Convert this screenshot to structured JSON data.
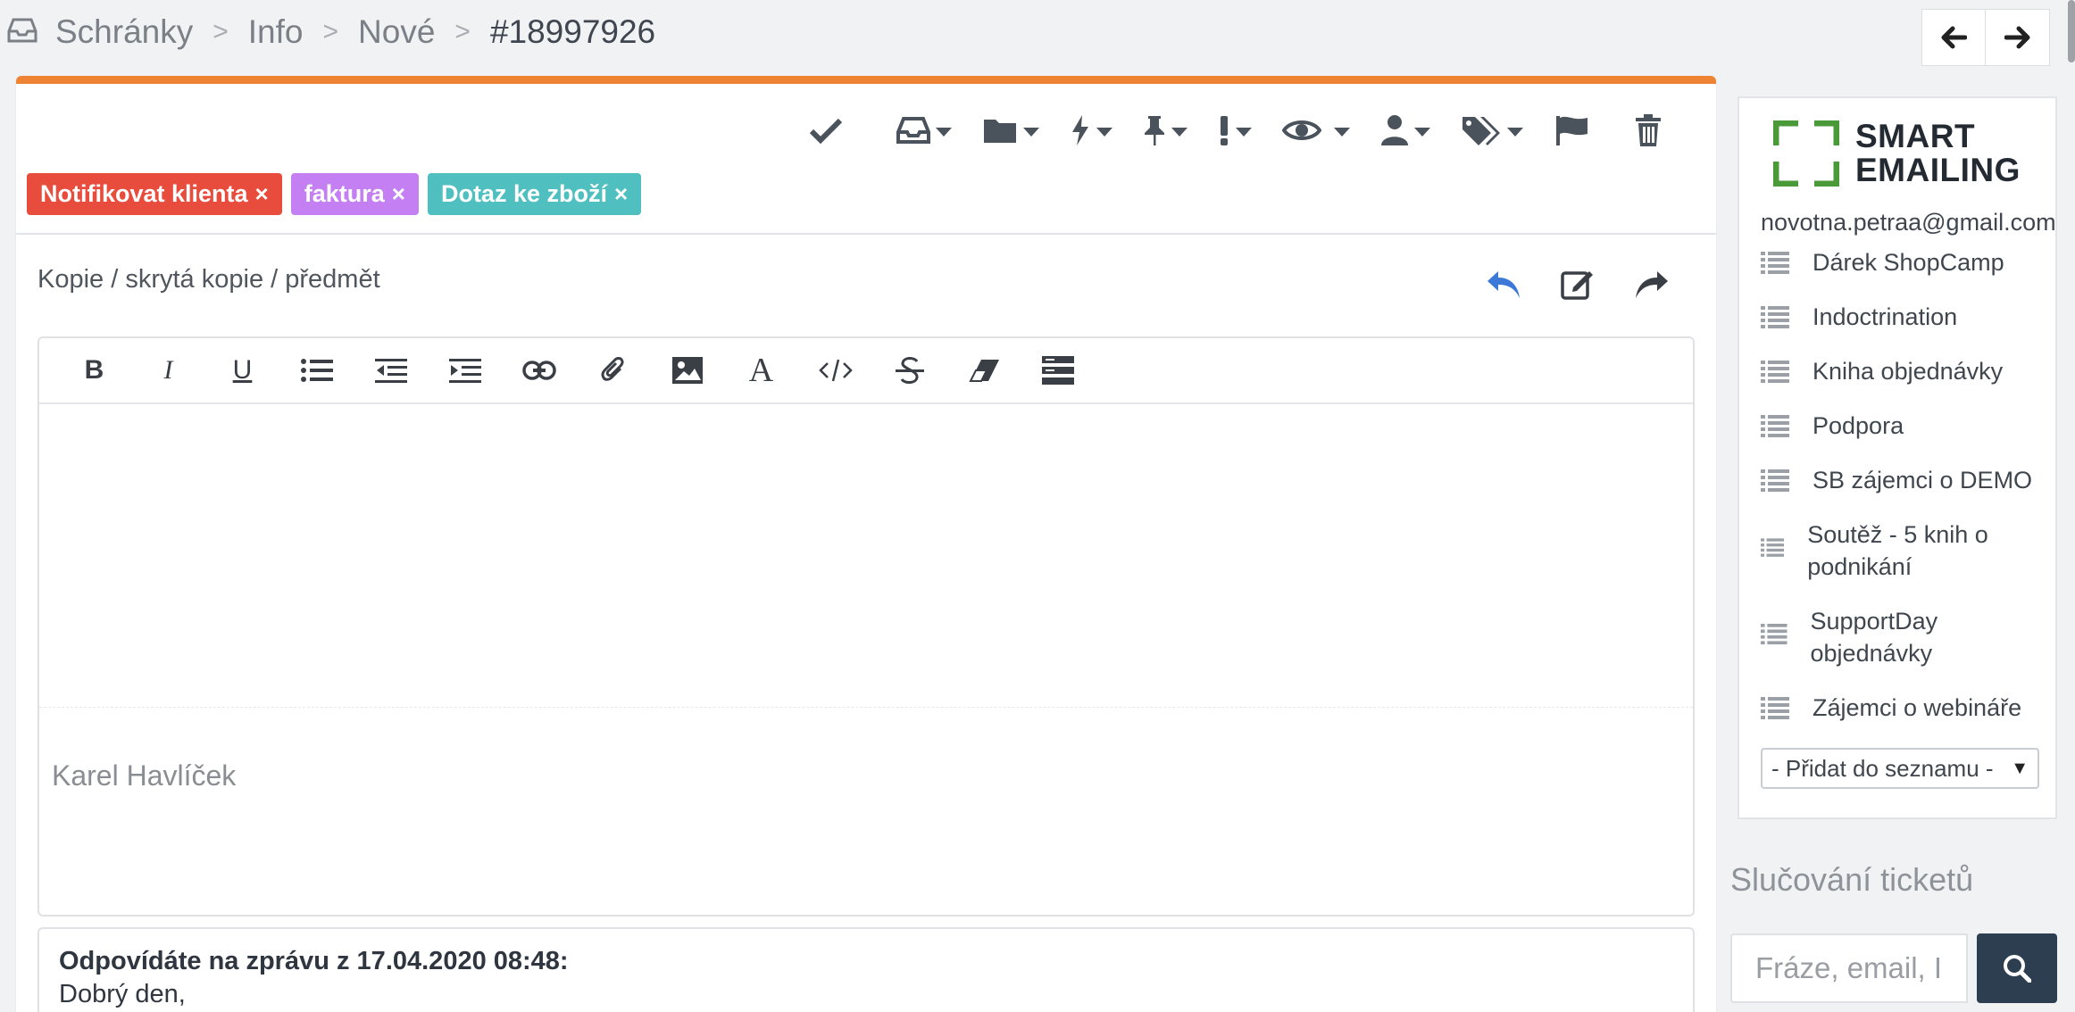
{
  "breadcrumb": {
    "items": [
      "Schránky",
      "Info",
      "Nové",
      "#18997926"
    ],
    "separator": ">"
  },
  "nav": {
    "prev_icon": "arrow-left-icon",
    "next_icon": "arrow-right-icon"
  },
  "colors": {
    "accent_bar": "#ee8433",
    "tag_notify": "#e74c3c",
    "tag_invoice": "#c47ff2",
    "tag_question": "#4fbfbf",
    "reply_blue": "#3b78d8",
    "search_button": "#2c3e50"
  },
  "toolbar": {
    "icons": [
      "check-icon",
      "inbox-icon",
      "folder-icon",
      "bolt-icon",
      "pin-icon",
      "priority-icon",
      "eye-icon",
      "user-icon",
      "tags-icon",
      "flag-icon",
      "trash-icon"
    ]
  },
  "tags": [
    {
      "label": "Notifikovat klienta",
      "remove": "×"
    },
    {
      "label": "faktura",
      "remove": "×"
    },
    {
      "label": "Dotaz ke zboží",
      "remove": "×"
    }
  ],
  "compose": {
    "cc_link": "Kopie / skrytá kopie / předmět",
    "signature": "Karel Havlíček"
  },
  "editor_toolbar": {
    "bold": "B",
    "italic": "I",
    "underline": "U",
    "font": "A"
  },
  "quote": {
    "header": "Odpovídáte na zprávu z 17.04.2020 08:48:",
    "body_first_line": "Dobrý den,"
  },
  "sidebar": {
    "brand_line1": "SMART",
    "brand_line2": "EMAILING",
    "email": "novotna.petraa@gmail.com",
    "lists": [
      "Dárek ShopCamp",
      "Indoctrination",
      "Kniha objednávky",
      "Podpora",
      "SB zájemci o DEMO",
      "Soutěž - 5 knih o podnikání",
      "SupportDay objednávky",
      "Zájemci o webináře"
    ],
    "add_to_list": "- Přidat do seznamu -",
    "add_to_list_arrow": "▼"
  },
  "merge": {
    "title": "Slučování ticketů",
    "search_placeholder": "Fráze, email, I"
  }
}
